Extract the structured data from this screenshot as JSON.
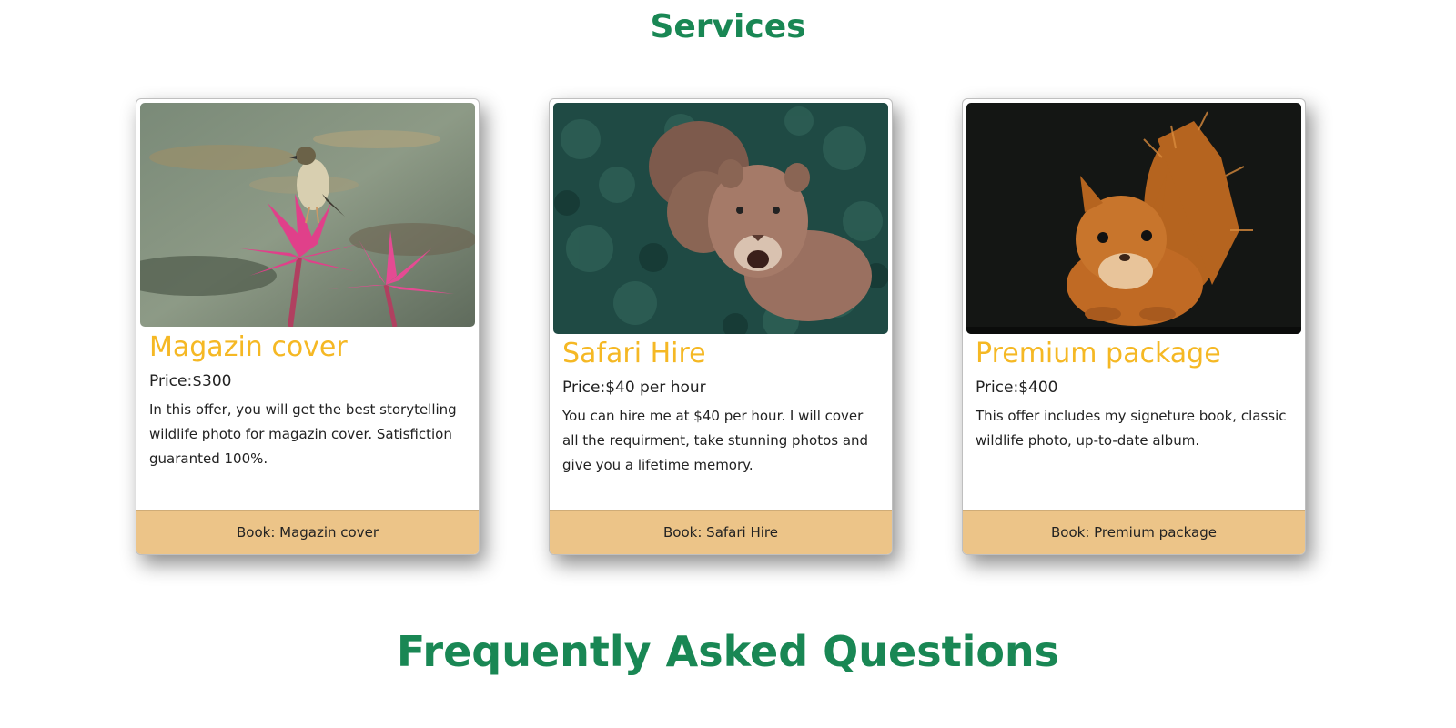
{
  "services": {
    "title": "Services",
    "cards": [
      {
        "title": "Magazin cover",
        "price": "Price:$300",
        "description": "In this offer, you will get the best storytelling wildlife photo for magazin cover. Satisfiction guaranted 100%.",
        "button": "Book: Magazin cover",
        "image": "bird-on-lotus-photo"
      },
      {
        "title": "Safari Hire",
        "price": "Price:$40 per hour",
        "description": "You can hire me at $40 per hour. I will cover all the requirment, take stunning photos and give you a lifetime memory.",
        "button": "Book: Safari Hire",
        "image": "lionesses-photo"
      },
      {
        "title": "Premium package",
        "price": "Price:$400",
        "description": "This offer includes my signeture book, classic wildlife photo, up-to-date album.",
        "button": "Book: Premium package",
        "image": "squirrel-photo"
      }
    ]
  },
  "faq": {
    "title": "Frequently Asked Questions"
  },
  "colors": {
    "heading_green": "#198754",
    "card_title_yellow": "#f5b824",
    "footer_tan": "#ecc488"
  }
}
